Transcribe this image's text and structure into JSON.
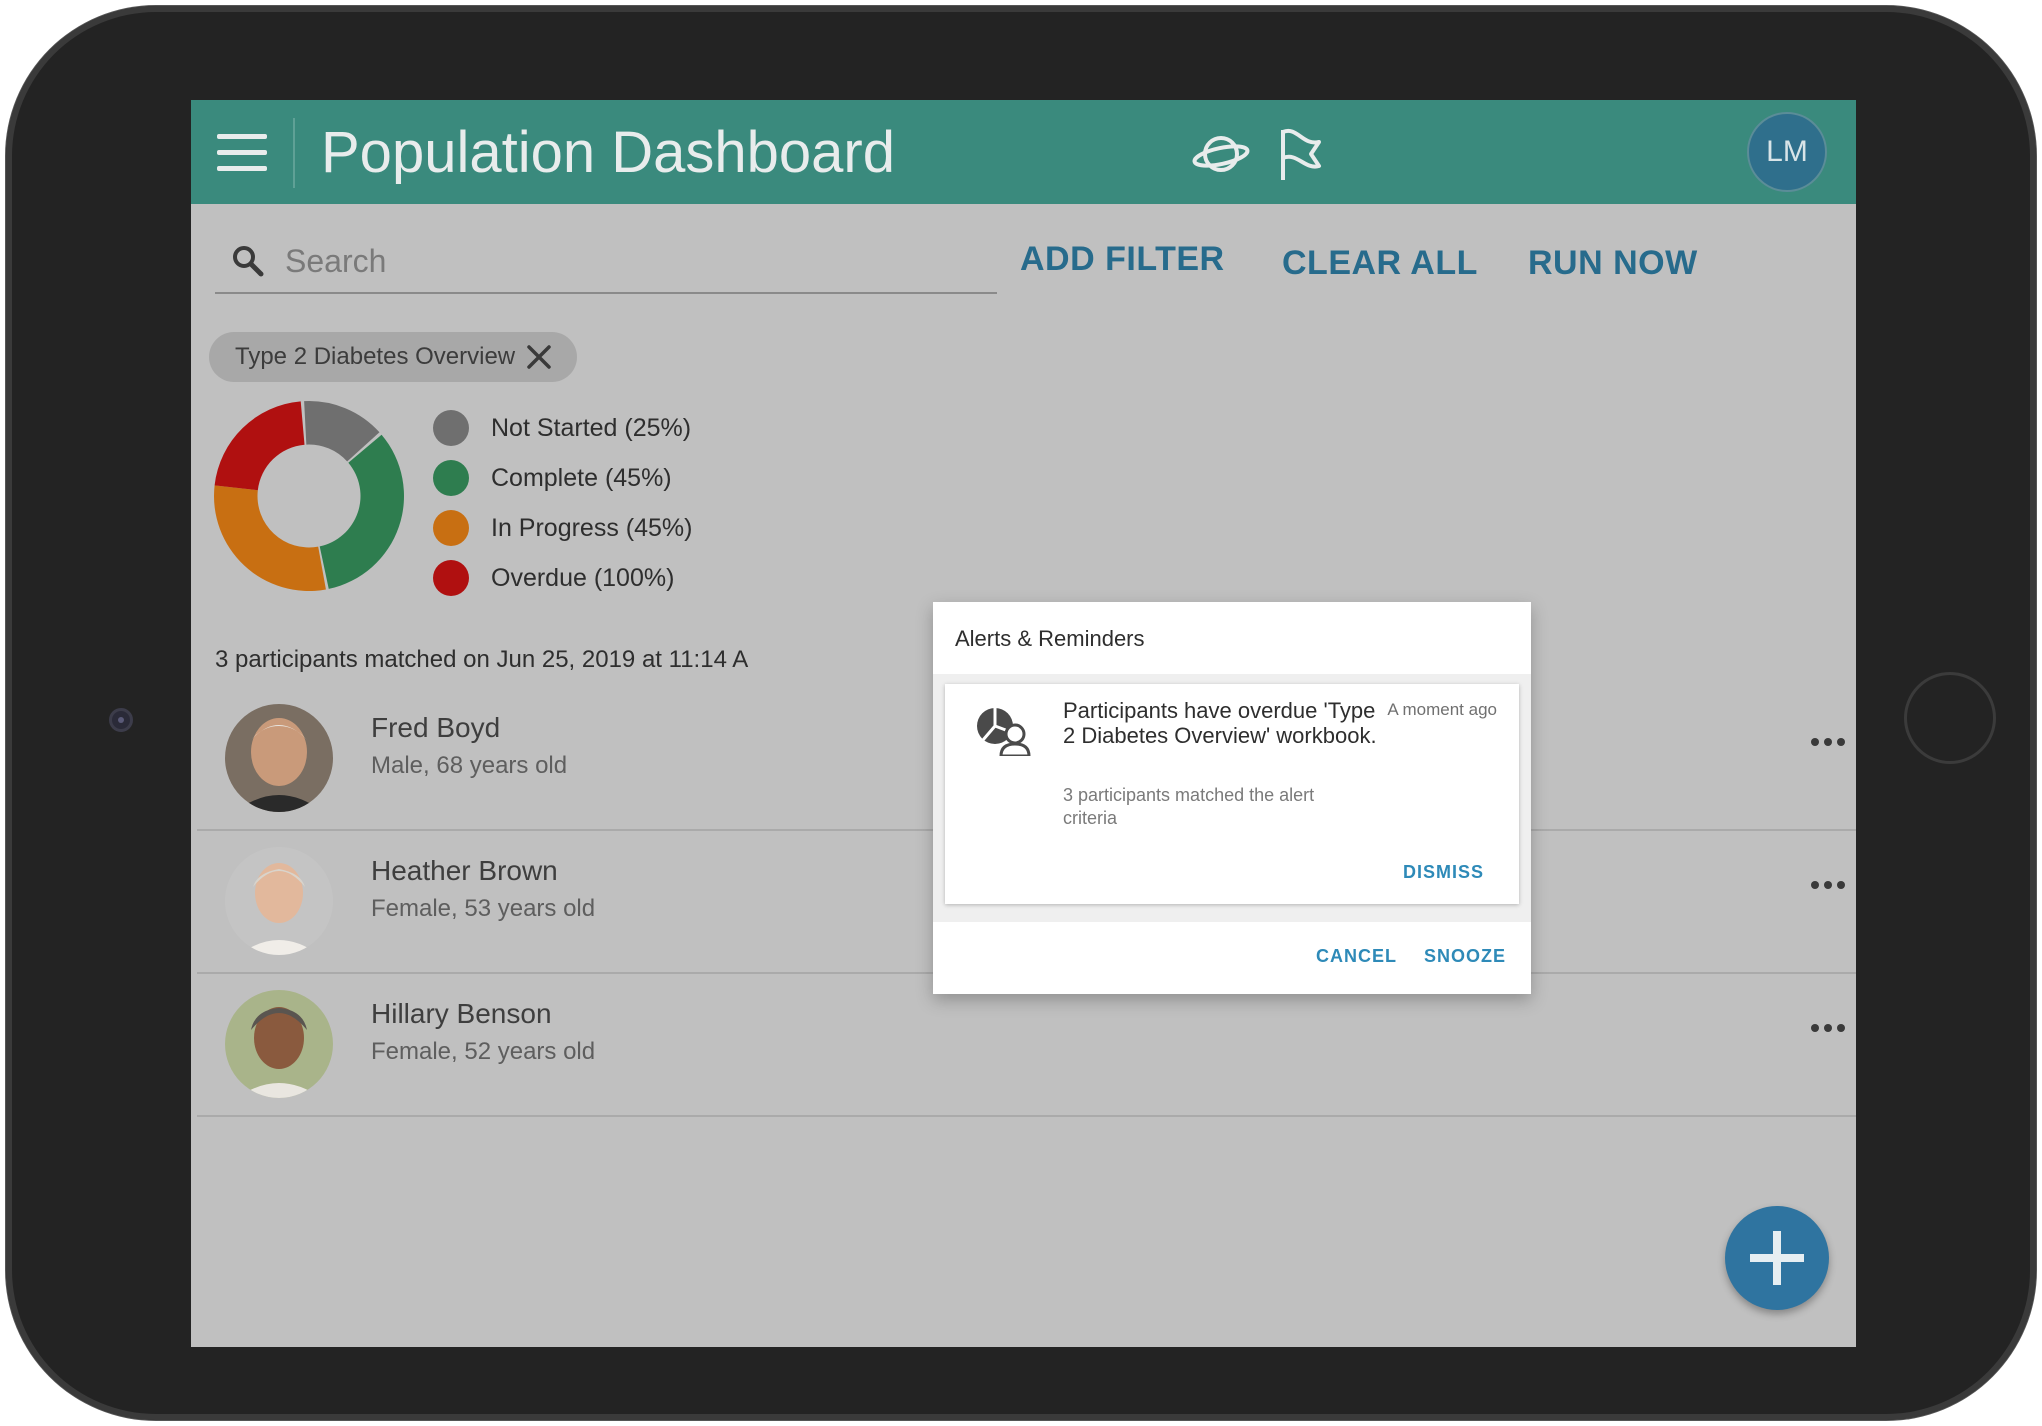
{
  "header": {
    "title": "Population Dashboard",
    "avatar_initials": "LM",
    "menu_icon": "hamburger-menu-icon",
    "icons": [
      "planet-icon",
      "flag-icon"
    ]
  },
  "toolbar": {
    "search_placeholder": "Search",
    "add_filter": "ADD FILTER",
    "clear_all": "CLEAR ALL",
    "run_now": "RUN NOW"
  },
  "filter_chip": {
    "label": "Type 2 Diabetes Overview"
  },
  "status_summary": {
    "legend": [
      {
        "label": "Not Started (25%)",
        "color": "#6f6f6f"
      },
      {
        "label": "Complete (45%)",
        "color": "#2e7d4f"
      },
      {
        "label": "In Progress  (45%)",
        "color": "#c86f12"
      },
      {
        "label": "Overdue  (100%)",
        "color": "#b01010"
      }
    ],
    "matched_text": "3 participants matched on Jun 25, 2019 at 11:14 A"
  },
  "participants": [
    {
      "name": "Fred Boyd",
      "details": "Male, 68 years old"
    },
    {
      "name": "Heather Brown",
      "details": "Female, 53 years old"
    },
    {
      "name": "Hillary Benson",
      "details": "Female, 52 years old"
    }
  ],
  "alerts_dialog": {
    "title": "Alerts & Reminders",
    "alert": {
      "title": "Participants have overdue 'Type 2 Diabetes Overview' workbook.",
      "time": "A moment ago",
      "body": "3 participants matched the alert criteria",
      "dismiss": "DISMISS"
    },
    "cancel": "CANCEL",
    "snooze": "SNOOZE"
  },
  "colors": {
    "appbar": "#3a8a7d",
    "accent": "#276b8c",
    "fab": "#2f74a0"
  }
}
